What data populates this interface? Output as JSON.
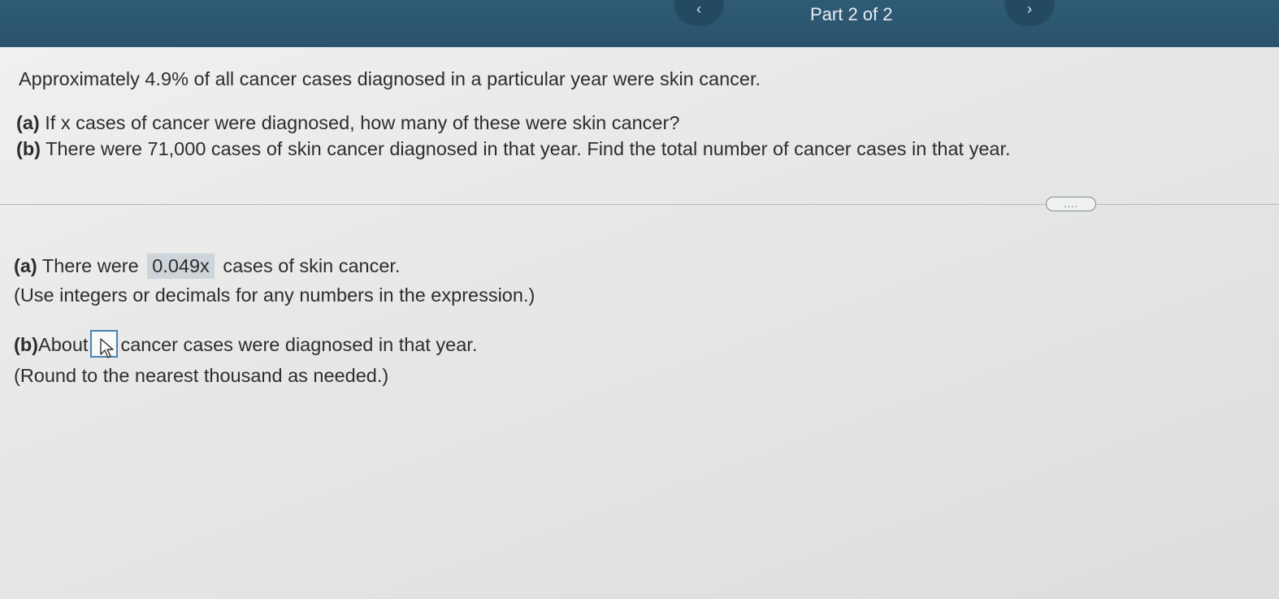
{
  "header": {
    "part_label": "Part 2 of 2",
    "prev_icon": "chevron-left-icon",
    "next_icon": "chevron-right-icon"
  },
  "problem": {
    "statement": "Approximately 4.9% of all cancer cases diagnosed in a particular year were skin cancer.",
    "part_a_label": "(a)",
    "part_a_text": "If x cases of cancer were diagnosed, how many of these were skin cancer?",
    "part_b_label": "(b)",
    "part_b_text": "There were 71,000 cases of skin cancer diagnosed in that year. Find the total number of cancer cases in that year."
  },
  "more_button": {
    "label": "....",
    "icon": "ellipsis-icon"
  },
  "answers": {
    "a": {
      "label": "(a)",
      "prefix": "There were",
      "value": "0.049x",
      "suffix": "cases of skin cancer.",
      "hint": "(Use integers or decimals for any numbers in the expression.)"
    },
    "b": {
      "label": "(b)",
      "prefix": "About",
      "value": "",
      "suffix": "cancer cases were diagnosed in that year.",
      "hint": "(Round to the nearest thousand as needed.)"
    }
  },
  "colors": {
    "header_bg": "#2f5b75",
    "input_border": "#4a82b3",
    "answer_highlight": "#cdd4da"
  }
}
